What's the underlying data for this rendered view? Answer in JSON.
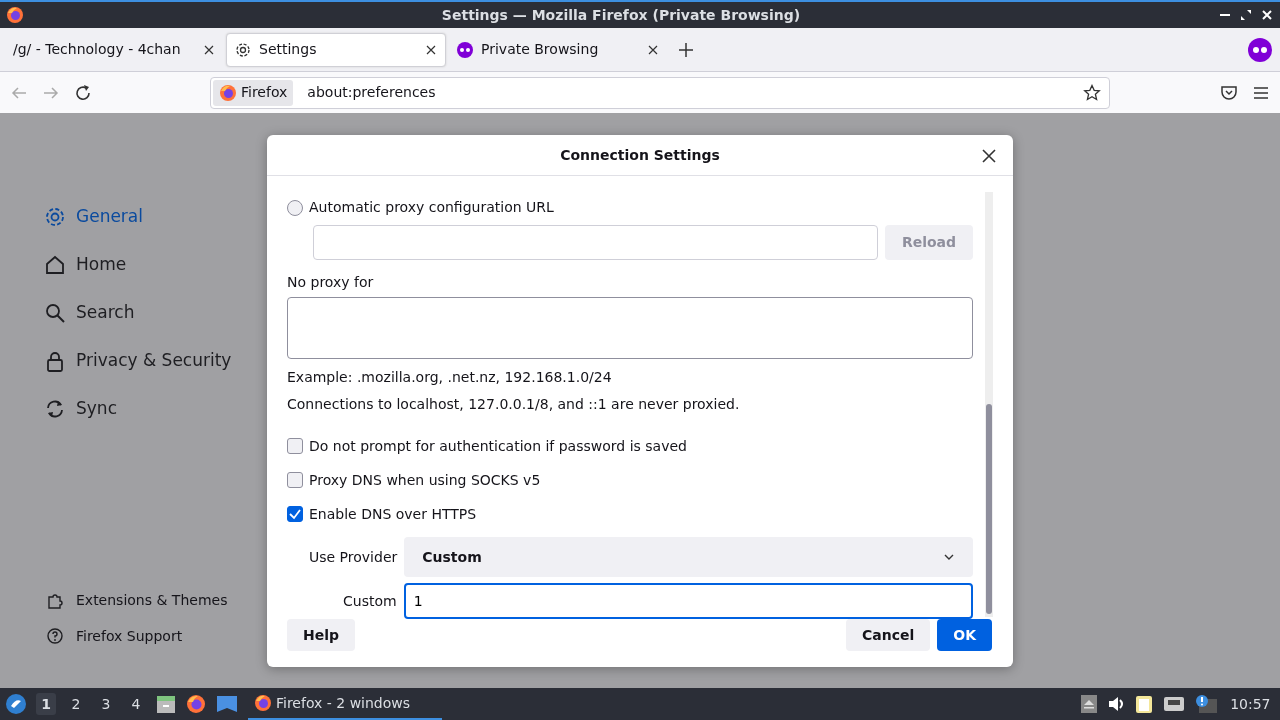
{
  "window": {
    "title": "Settings — Mozilla Firefox (Private Browsing)"
  },
  "tabs": [
    {
      "label": "/g/ - Technology - 4chan",
      "selected": false,
      "kind": "page"
    },
    {
      "label": "Settings",
      "selected": true,
      "kind": "settings"
    },
    {
      "label": "Private Browsing",
      "selected": false,
      "kind": "private"
    }
  ],
  "toolbar": {
    "identity": "Firefox",
    "url": "about:preferences"
  },
  "sidebar": {
    "items": [
      {
        "label": "General",
        "selected": true,
        "kind": "gear"
      },
      {
        "label": "Home",
        "selected": false,
        "kind": "home"
      },
      {
        "label": "Search",
        "selected": false,
        "kind": "search"
      },
      {
        "label": "Privacy & Security",
        "selected": false,
        "kind": "lock"
      },
      {
        "label": "Sync",
        "selected": false,
        "kind": "sync"
      }
    ],
    "footer": [
      {
        "label": "Extensions & Themes",
        "kind": "puzzle"
      },
      {
        "label": "Firefox Support",
        "kind": "help"
      }
    ]
  },
  "dialog": {
    "title": "Connection Settings",
    "proxy_url": {
      "label": "Automatic proxy configuration URL",
      "selected": false
    },
    "reload_button": {
      "label": "Reload",
      "disabled": true
    },
    "no_proxy": {
      "label": "No proxy for"
    },
    "example": "Example: .mozilla.org, .net.nz, 192.168.1.0/24",
    "note": "Connections to localhost, 127.0.0.1/8, and ::1 are never proxied.",
    "options": [
      {
        "label": "Do not prompt for authentication if password is saved",
        "checked": false
      },
      {
        "label": "Proxy DNS when using SOCKS v5",
        "checked": false
      },
      {
        "label": "Enable DNS over HTTPS",
        "checked": true
      }
    ],
    "provider": {
      "label": "Use Provider",
      "value": "Custom"
    },
    "custom": {
      "label": "Custom",
      "value": "1"
    },
    "help_button": {
      "label": "Help"
    },
    "cancel_button": "Cancel",
    "ok_button": "OK"
  },
  "taskbar": {
    "workspaces": [
      {
        "label": "1",
        "selected": true
      },
      {
        "label": "2",
        "selected": false
      },
      {
        "label": "3",
        "selected": false
      },
      {
        "label": "4",
        "selected": false
      }
    ],
    "task": "Firefox - 2 windows",
    "clock": "10:57"
  }
}
